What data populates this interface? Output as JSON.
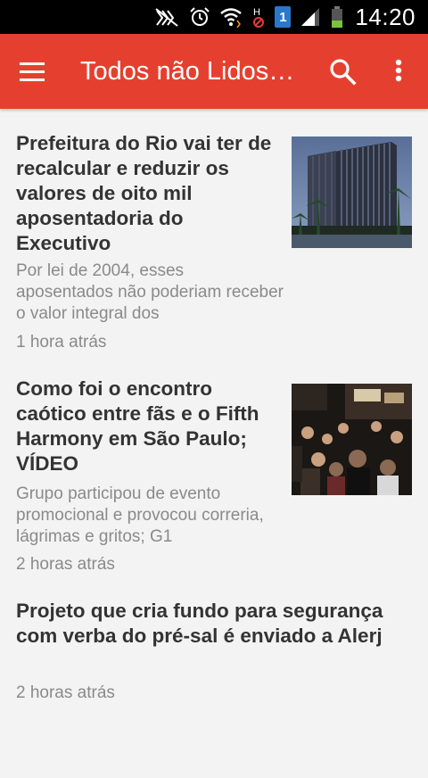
{
  "status_bar": {
    "time": "14:20",
    "sim_slot": "1",
    "icons": [
      "mute-icon",
      "alarm-icon",
      "wifi-icon",
      "h-data-blocked-icon",
      "sim-icon",
      "signal-icon",
      "battery-icon"
    ]
  },
  "app_bar": {
    "title": "Todos não Lidos…",
    "background_color": "#e5402f",
    "icons": [
      "menu-icon",
      "search-icon",
      "more-vert-icon"
    ]
  },
  "articles": [
    {
      "title": "Prefeitura do Rio vai ter de recalcular e reduzir os valores de oito mil aposentadoria do Executivo",
      "summary": "Por lei de 2004, esses aposentados não poderiam receber o valor integral dos",
      "time": "1 hora atrás",
      "image": "building-photo"
    },
    {
      "title": "Como foi o encontro caótico entre fãs e o Fifth Harmony em São Paulo; VÍDEO",
      "summary": "Grupo participou de evento promocional e provocou correria, lágrimas e gritos; G1",
      "time": "2 horas atrás",
      "image": "crowd-photo"
    },
    {
      "title": "Projeto que cria fundo para segurança com verba do pré-sal é enviado a Alerj",
      "summary": "",
      "time": "2 horas atrás",
      "image": ""
    }
  ]
}
